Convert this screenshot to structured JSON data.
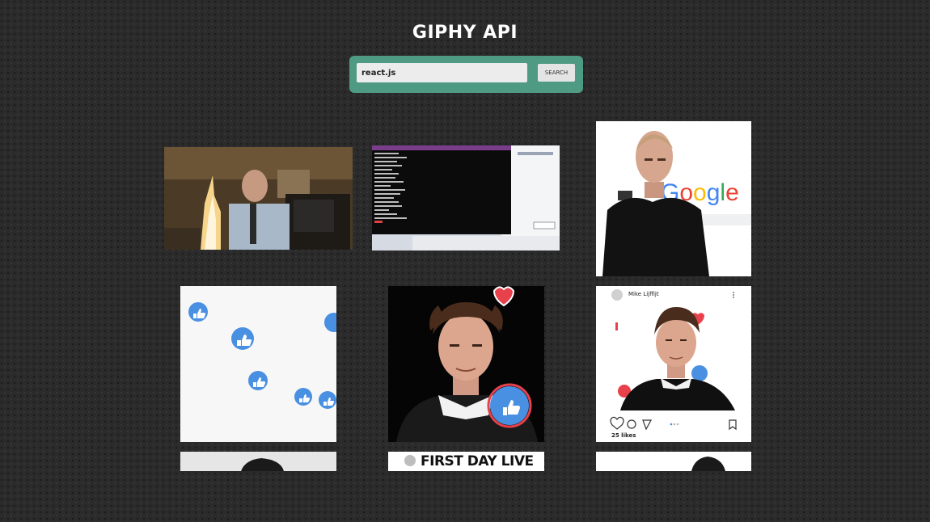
{
  "header": {
    "title": "GIPHY API"
  },
  "search": {
    "value": "react.js",
    "button_label": "SEARCH"
  },
  "gifs": [
    {
      "name": "gif-office-fire",
      "text": ""
    },
    {
      "name": "gif-terminal-screen",
      "text": ""
    },
    {
      "name": "gif-man-google",
      "text": ""
    },
    {
      "name": "gif-like-buttons",
      "text": ""
    },
    {
      "name": "gif-man-hearts-likes",
      "text": ""
    },
    {
      "name": "gif-instagram-post",
      "username": "Mike Lijffijt",
      "likes": "25 likes"
    },
    {
      "name": "gif-partial-portrait-1",
      "text": ""
    },
    {
      "name": "gif-first-day-live",
      "text": "FIRST DAY LIVE"
    },
    {
      "name": "gif-partial-portrait-2",
      "text": ""
    }
  ],
  "colors": {
    "search_bar": "#4f9a82",
    "background": "#2b2b2b",
    "like_blue": "#4a90e2",
    "heart_red": "#e8414c"
  }
}
